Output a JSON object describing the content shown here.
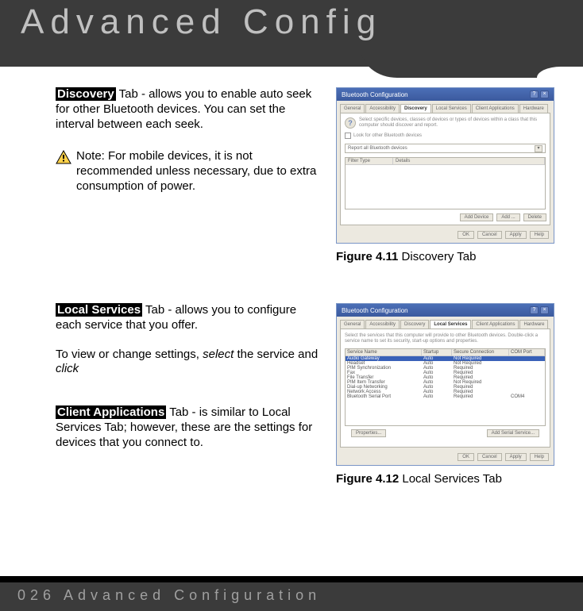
{
  "header": {
    "title": "Advanced Config"
  },
  "footer": {
    "text": "026 Advanced Configuration"
  },
  "discovery": {
    "tag": "Discovery",
    "desc": " Tab - allows you to enable auto seek for other Bluetooth devices. You can set the interval between each seek.",
    "note": "Note: For mobile devices, it is not recommended unless necessary, due to extra consumption of power.",
    "caption_bold": "Figure 4.11",
    "caption_rest": " Discovery Tab"
  },
  "local": {
    "tag": "Local Services",
    "desc": " Tab - allows you to configure each service that you offer.",
    "para_pre": "To view or change settings, ",
    "para_ital1": "select",
    "para_mid": " the service and ",
    "para_ital2": "click",
    "caption_bold": "Figure 4.12",
    "caption_rest": " Local Services Tab"
  },
  "client": {
    "tag": "Client Applications",
    "desc": " Tab - is similar to Local Services Tab; however, these are the settings for devices that you connect to."
  },
  "dlg": {
    "title": "Bluetooth Configuration",
    "tabs": [
      "General",
      "Accessibility",
      "Discovery",
      "Local Services",
      "Client Applications",
      "Hardware"
    ],
    "hint1": "Select specific devices, classes of devices or types of devices within a class that this computer should discover and report.",
    "chk": "Look for other Bluetooth devices",
    "combo": "Report all Bluetooth devices",
    "list_hdr": [
      "Filter Type",
      "Details"
    ],
    "btns_small": [
      "Add Device",
      "Add ...",
      "Delete"
    ],
    "footer_btns": [
      "OK",
      "Cancel",
      "Apply",
      "Help"
    ],
    "hint2": "Select the services that this computer will provide to other Bluetooth devices. Double-click a service name to set its security, start-up options and properties.",
    "svc_hdr": [
      "Service Name",
      "Startup",
      "Secure Connection",
      "COM Port"
    ],
    "services": [
      {
        "name": "Audio Gateway",
        "startup": "Auto",
        "secure": "Not Required",
        "com": ""
      },
      {
        "name": "Headset",
        "startup": "Auto",
        "secure": "Not Required",
        "com": ""
      },
      {
        "name": "PIM Synchronization",
        "startup": "Auto",
        "secure": "Required",
        "com": ""
      },
      {
        "name": "Fax",
        "startup": "Auto",
        "secure": "Required",
        "com": ""
      },
      {
        "name": "File Transfer",
        "startup": "Auto",
        "secure": "Required",
        "com": ""
      },
      {
        "name": "PIM Item Transfer",
        "startup": "Auto",
        "secure": "Not Required",
        "com": ""
      },
      {
        "name": "Dial-up Networking",
        "startup": "Auto",
        "secure": "Required",
        "com": ""
      },
      {
        "name": "Network Access",
        "startup": "Auto",
        "secure": "Required",
        "com": ""
      },
      {
        "name": "Bluetooth Serial Port",
        "startup": "Auto",
        "secure": "Required",
        "com": "COM4"
      }
    ],
    "props": "Properties...",
    "addsvc": "Add Serial Service..."
  }
}
